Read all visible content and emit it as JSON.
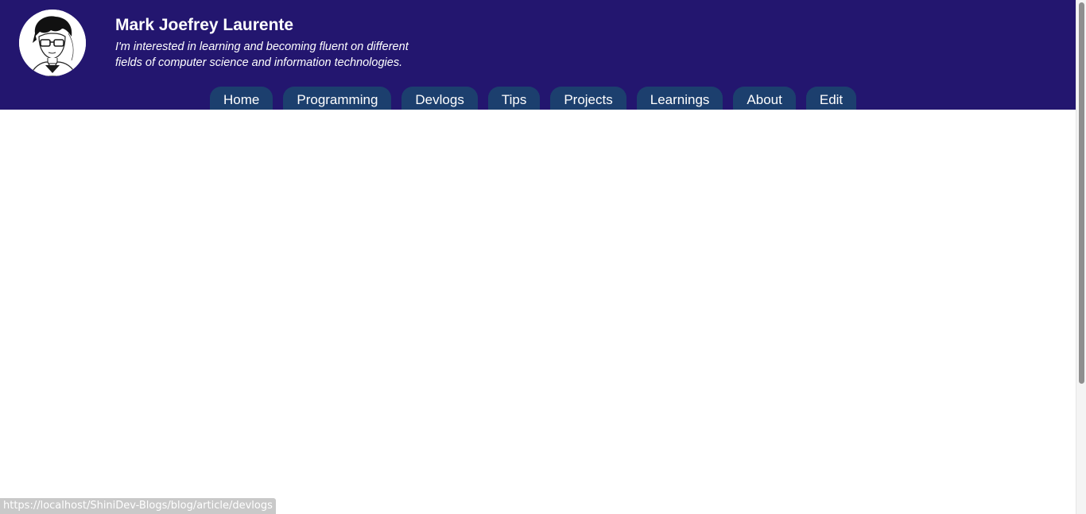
{
  "profile": {
    "name": "Mark Joefrey Laurente",
    "tagline": "I'm interested in learning and becoming fluent on different fields of computer science and information technologies.",
    "avatar_icon": "user-portrait-icon"
  },
  "nav": {
    "items": [
      {
        "label": "Home"
      },
      {
        "label": "Programming"
      },
      {
        "label": "Devlogs"
      },
      {
        "label": "Tips"
      },
      {
        "label": "Projects"
      },
      {
        "label": "Learnings"
      },
      {
        "label": "About"
      },
      {
        "label": "Edit"
      }
    ]
  },
  "status_bar": {
    "url": "https://localhost/ShiniDev-Blogs/blog/article/devlogs"
  },
  "colors": {
    "header_bg": "#23166f",
    "nav_item_bg": "#1c3f6e",
    "text": "#ffffff"
  }
}
